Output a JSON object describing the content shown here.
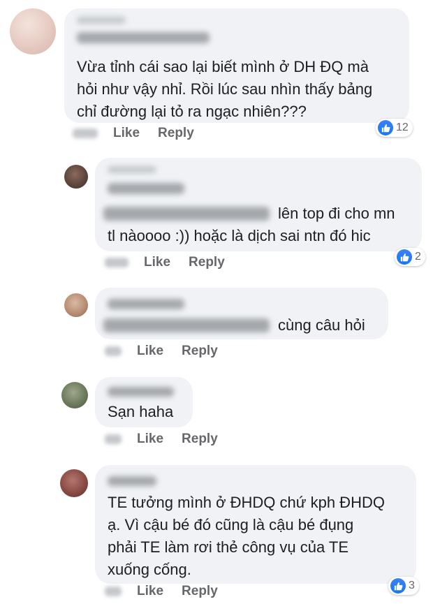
{
  "comments": [
    {
      "text_lines": [
        "Vừa tỉnh cái sao lại biết mình ở DH ĐQ mà",
        "hỏi như vậy nhỉ. Rồi lúc sau nhìn thấy bảng",
        "chỉ đường lại tỏ ra ngạc nhiên???"
      ],
      "like_label": "Like",
      "reply_label": "Reply",
      "reaction_count": "12",
      "reaction_icon": "like-icon"
    },
    {
      "text_lines": [
        "lên top đi cho mn",
        "tl nàoooo :)) hoặc là dịch sai ntn đó hic"
      ],
      "like_label": "Like",
      "reply_label": "Reply",
      "reaction_count": "2",
      "reaction_icon": "like-icon"
    },
    {
      "text_lines": [
        "cùng câu hỏi"
      ],
      "like_label": "Like",
      "reply_label": "Reply"
    },
    {
      "text_lines": [
        "Sạn haha"
      ],
      "like_label": "Like",
      "reply_label": "Reply"
    },
    {
      "text_lines": [
        "TE tưởng mình ở ĐHDQ chứ kph ĐHDQ",
        "ạ. Vì cậu bé đó cũng là cậu bé đụng",
        "phải TE làm rơi thẻ công vụ của TE",
        "xuống cống."
      ],
      "like_label": "Like",
      "reply_label": "Reply",
      "reaction_count": "3",
      "reaction_icon": "like-icon"
    }
  ],
  "colors": {
    "bubble_bg": "#f0f2f5",
    "text": "#1c1e21",
    "meta": "#65676b",
    "like_blue": "#1877f2"
  }
}
